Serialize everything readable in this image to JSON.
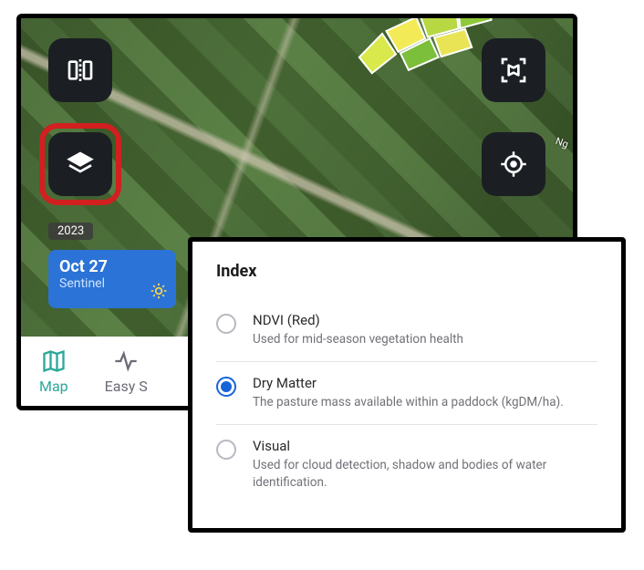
{
  "map": {
    "year_badge": "2023",
    "road_label": "Ng",
    "date_card": {
      "date": "Oct 27",
      "source": "Sentinel"
    }
  },
  "toolbar": {
    "compare": "compare",
    "layers": "layers",
    "frame": "frame-map",
    "locate": "locate-me"
  },
  "tabs": {
    "map": "Map",
    "easy_scan": "Easy S"
  },
  "index_panel": {
    "heading": "Index",
    "options": [
      {
        "id": "ndvi",
        "title": "NDVI (Red)",
        "desc": "Used for mid-season vegetation health",
        "selected": false
      },
      {
        "id": "dry_matter",
        "title": "Dry Matter",
        "desc": "The pasture mass available within a paddock (kgDM/ha).",
        "selected": true
      },
      {
        "id": "visual",
        "title": "Visual",
        "desc": "Used for cloud detection, shadow and bodies of water identification.",
        "selected": false
      }
    ]
  }
}
